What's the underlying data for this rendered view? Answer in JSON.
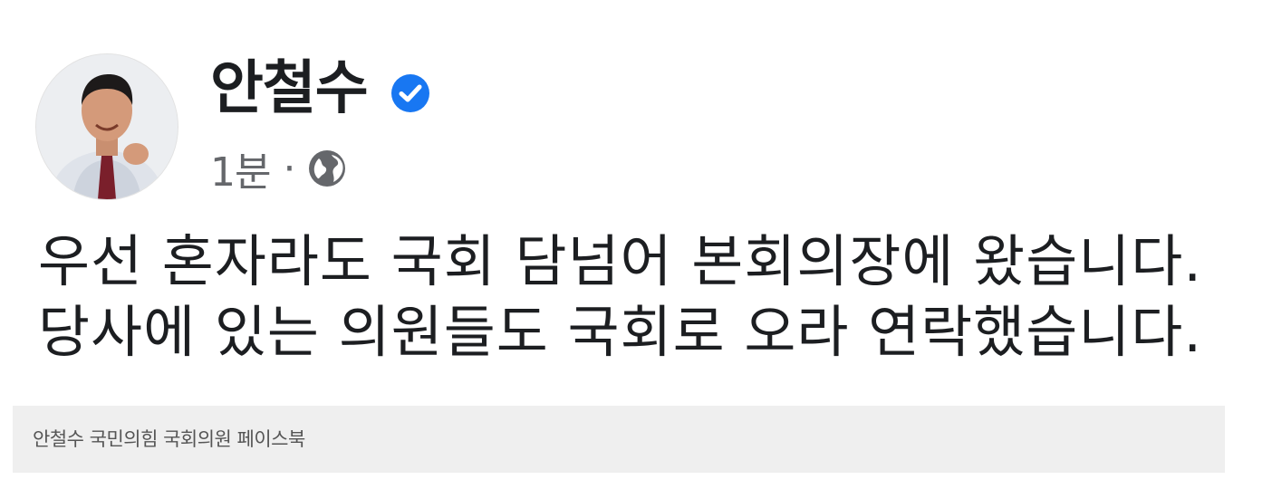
{
  "post": {
    "author_name": "안철수",
    "verified": true,
    "time": "1분",
    "separator": "·",
    "privacy_icon": "globe-icon",
    "avatar_icon": "profile-photo",
    "text_lines": [
      "우선 혼자라도 국회 담넘어 본회의장에 왔습니다.",
      "당사에 있는 의원들도 국회로 오라 연락했습니다."
    ]
  },
  "caption": "안철수 국민의힘 국회의원 페이스북",
  "colors": {
    "verified_blue": "#1877f2",
    "text_primary": "#1c1e21",
    "text_secondary": "#65676b",
    "caption_bg": "#efefef"
  }
}
